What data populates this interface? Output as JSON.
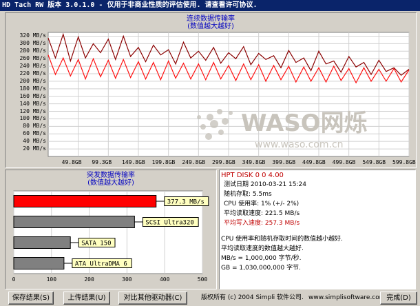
{
  "window": {
    "title": "HD Tach RW 版本 3.0.1.0 - 仅用于非商业性质的评估使用. 请查看许可协议."
  },
  "colors": {
    "read_line": "#ff1010",
    "write_line": "#8b0000",
    "burst_bar_highlight": "#ff0000",
    "burst_bar_default": "#808080",
    "label_bg": "#ffffc0",
    "title_color": "#0000c0",
    "drive_name_color": "#c00000"
  },
  "sequential_chart": {
    "title_line1": "连续数据传输率",
    "title_line2": "(数值越大越好)",
    "y_ticks": [
      "320 MB/s",
      "300 MB/s",
      "280 MB/s",
      "260 MB/s",
      "240 MB/s",
      "220 MB/s",
      "200 MB/s",
      "180 MB/s",
      "160 MB/s",
      "140 MB/s",
      "120 MB/s",
      "100 MB/s",
      "80 MB/s",
      "60 MB/s",
      "40 MB/s",
      "20 MB/s"
    ],
    "x_ticks": [
      "49.8GB",
      "99.3GB",
      "149.8GB",
      "199.8GB",
      "249.8GB",
      "299.8GB",
      "349.8GB",
      "399.8GB",
      "449.8GB",
      "499.8GB",
      "549.8GB",
      "599.8GB"
    ]
  },
  "chart_data": [
    {
      "type": "line",
      "title": "连续数据传输率 (数值越大越好)",
      "xlabel": "",
      "ylabel": "",
      "ylim": [
        0,
        330
      ],
      "xlim": [
        0,
        600
      ],
      "grid": true,
      "series": [
        {
          "color": "#ff1010",
          "x": [
            0,
            12,
            25,
            37,
            50,
            62,
            75,
            87,
            100,
            112,
            125,
            137,
            150,
            162,
            175,
            187,
            200,
            212,
            225,
            237,
            250,
            262,
            275,
            287,
            300,
            312,
            325,
            337,
            350,
            362,
            375,
            387,
            400,
            412,
            425,
            437,
            450,
            462,
            475,
            487,
            500,
            512,
            525,
            537,
            550,
            562,
            575,
            587,
            600
          ],
          "values": [
            270,
            218,
            262,
            214,
            258,
            206,
            260,
            212,
            256,
            208,
            258,
            210,
            252,
            206,
            250,
            204,
            254,
            208,
            248,
            206,
            246,
            204,
            250,
            206,
            242,
            202,
            246,
            204,
            244,
            200,
            242,
            204,
            240,
            198,
            238,
            200,
            236,
            198,
            240,
            202,
            234,
            196,
            236,
            200,
            232,
            200,
            234,
            198,
            230
          ]
        },
        {
          "color": "#8b0000",
          "x": [
            0,
            12,
            25,
            37,
            50,
            62,
            75,
            87,
            100,
            112,
            125,
            137,
            150,
            162,
            175,
            187,
            200,
            212,
            225,
            237,
            250,
            262,
            275,
            287,
            300,
            312,
            325,
            337,
            350,
            362,
            375,
            387,
            400,
            412,
            425,
            437,
            450,
            462,
            475,
            487,
            500,
            512,
            525,
            537,
            550,
            562,
            575,
            587,
            600
          ],
          "values": [
            315,
            262,
            325,
            254,
            318,
            262,
            300,
            276,
            312,
            258,
            320,
            266,
            290,
            252,
            296,
            270,
            284,
            246,
            304,
            262,
            280,
            256,
            290,
            248,
            276,
            260,
            292,
            244,
            274,
            258,
            268,
            236,
            282,
            250,
            262,
            228,
            280,
            246,
            254,
            224,
            266,
            238,
            250,
            218,
            256,
            226,
            236,
            216,
            232
          ]
        }
      ]
    },
    {
      "type": "bar",
      "title": "突发数据传输率 (数值越大越好)",
      "xlabel": "",
      "ylabel": "",
      "xlim": [
        0,
        500
      ],
      "grid": true,
      "categories": [
        "377.3 MB/s",
        "SCSI Ultra320",
        "SATA 150",
        "ATA UltraDMA 6"
      ],
      "values": [
        377.3,
        320,
        150,
        133
      ],
      "x_ticks": [
        "0",
        "100",
        "200",
        "300",
        "400",
        "500"
      ]
    }
  ],
  "burst_chart": {
    "title_line1": "突发数据传输率",
    "title_line2": "(数值越大越好)",
    "bar_labels": [
      "377.3 MB/s",
      "SCSI Ultra320",
      "SATA 150",
      "ATA UltraDMA 6"
    ],
    "x_ticks": [
      "0",
      "100",
      "200",
      "300",
      "400",
      "500"
    ]
  },
  "info": {
    "drive_name": "HPT DISK 0 0 4.00",
    "test_date": "测试日期 2010-03-21    15:24",
    "random_access": "随机存取: 5.5ms",
    "cpu_usage": "CPU 使用率: 1% (+/- 2%)",
    "avg_read": "平均读取速度: 221.5 MB/s",
    "avg_write": "平均写入速度: 257.3 MB/s",
    "note1": "CPU 使用率和随机存取时间的数值越小越好.",
    "note2": "平均读取速度的数值越大越好.",
    "note3": "MB/s = 1,000,000 字节/秒.",
    "note4": "GB = 1,030,000,000 字节."
  },
  "footer": {
    "save_button": "保存结果(S)",
    "upload_button": "上传结果(U)",
    "compare_button": "对比其他驱动器(C)",
    "copyright": "版权所有 (c) 2004 Simpli 软件公司.",
    "website": "www.simplisoftware.com",
    "done_button": "完成(D)"
  },
  "watermark": {
    "brand": "WASO网烁",
    "url": "www.waso.com.cn"
  }
}
